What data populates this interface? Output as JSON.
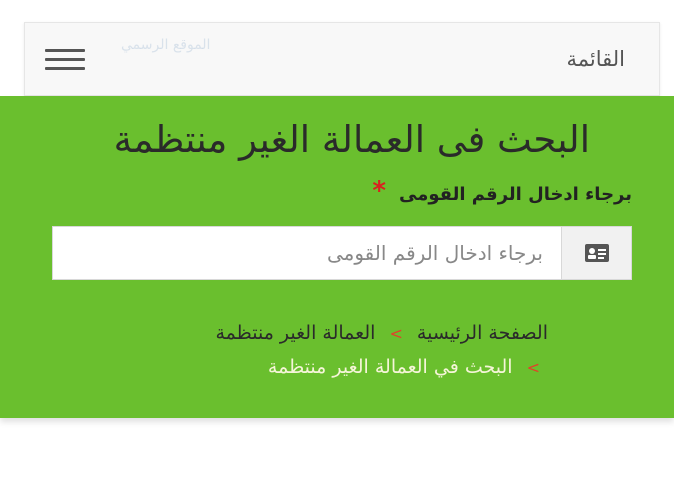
{
  "nav": {
    "title": "القائمة",
    "watermark": "الموقع الرسمي"
  },
  "hero": {
    "heading": "البحث فى العمالة الغير منتظمة",
    "field_label": "برجاء ادخال الرقم القومى",
    "required_mark": "*",
    "input_value": "",
    "input_placeholder": "برجاء ادخال الرقم القومى"
  },
  "breadcrumb": {
    "home": "الصفحة الرئيسية",
    "section": "العمالة الغير منتظمة",
    "current": "البحث في العمالة الغير منتظمة",
    "separator": ">"
  },
  "colors": {
    "panel": "#6abf2e",
    "separator": "#e2412a",
    "required": "#d92020"
  },
  "icons": {
    "menu": "hamburger-icon",
    "id_card": "id-card-icon"
  }
}
